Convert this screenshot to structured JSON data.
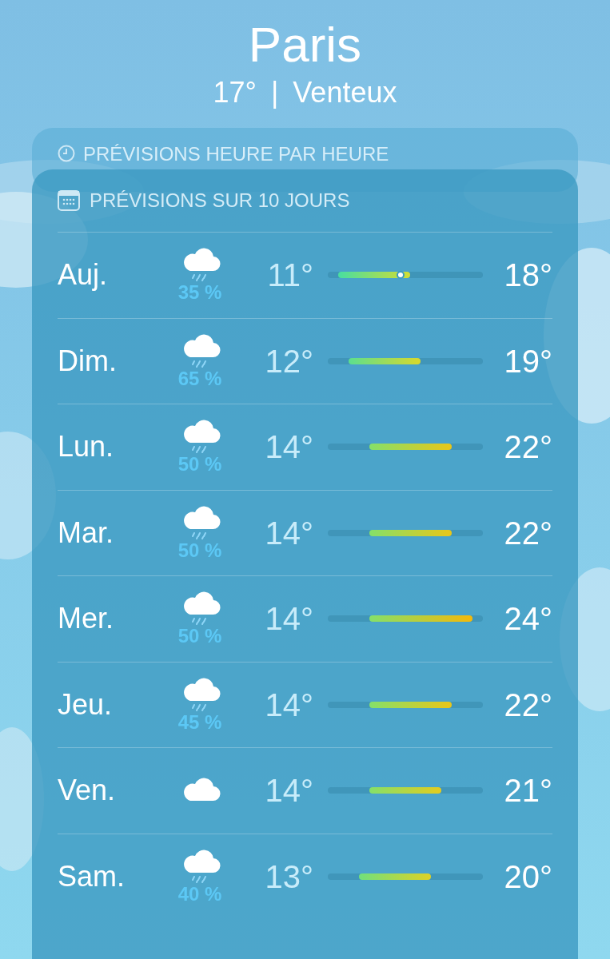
{
  "city": "Paris",
  "current": {
    "temperature": "17°",
    "separator": "|",
    "condition": "Venteux"
  },
  "hourly_card": {
    "title": "PRÉVISIONS HEURE PAR HEURE"
  },
  "daily_card": {
    "title": "PRÉVISIONS SUR 10 JOURS",
    "rows": [
      {
        "day": "Auj.",
        "kind": "rain",
        "precipitation": "35 %",
        "low": "11°",
        "high": "18°",
        "now": true
      },
      {
        "day": "Dim.",
        "kind": "rain",
        "precipitation": "65 %",
        "low": "12°",
        "high": "19°",
        "now": false
      },
      {
        "day": "Lun.",
        "kind": "rain",
        "precipitation": "50 %",
        "low": "14°",
        "high": "22°",
        "now": false
      },
      {
        "day": "Mar.",
        "kind": "rain",
        "precipitation": "50 %",
        "low": "14°",
        "high": "22°",
        "now": false
      },
      {
        "day": "Mer.",
        "kind": "rain",
        "precipitation": "50 %",
        "low": "14°",
        "high": "24°",
        "now": false
      },
      {
        "day": "Jeu.",
        "kind": "rain",
        "precipitation": "45 %",
        "low": "14°",
        "high": "22°",
        "now": false
      },
      {
        "day": "Ven.",
        "kind": "cloud",
        "low": "14°",
        "high": "21°",
        "now": false
      },
      {
        "day": "Sam.",
        "kind": "rain",
        "precipitation": "40 %",
        "low": "13°",
        "high": "20°",
        "now": false
      }
    ]
  }
}
